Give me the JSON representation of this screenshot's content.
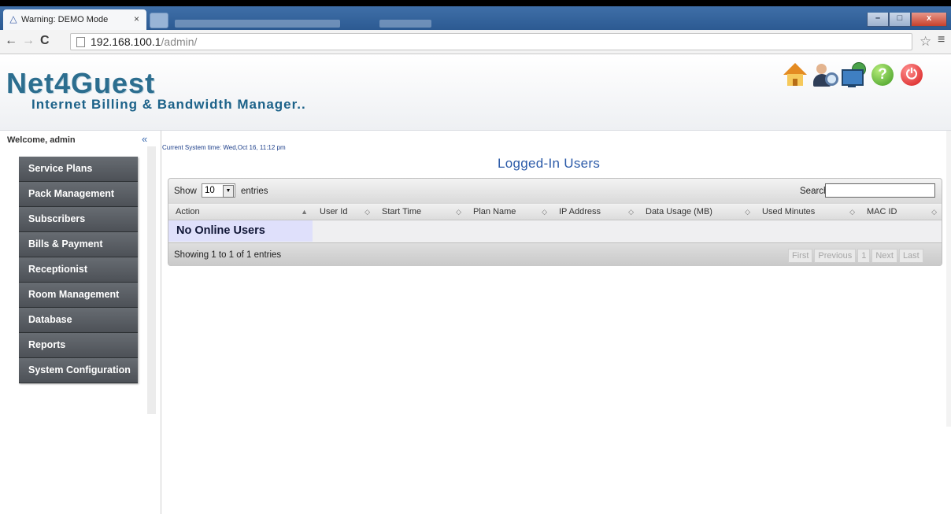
{
  "browser": {
    "tab_title": "Warning: DEMO Mode",
    "tab_close": "×",
    "url_host": "192.168.100.1",
    "url_path": "/admin/"
  },
  "header": {
    "brand": "Net4Guest",
    "tagline": "Internet Billing & Bandwidth Manager..",
    "icons": [
      "home-icon",
      "user-search-icon",
      "network-icon",
      "help-icon",
      "power-icon"
    ]
  },
  "sidebar": {
    "welcome": "Welcome, admin",
    "collapse": "«",
    "items": [
      {
        "label": "Service Plans"
      },
      {
        "label": "Pack Management"
      },
      {
        "label": "Subscribers"
      },
      {
        "label": "Bills & Payment"
      },
      {
        "label": "Receptionist"
      },
      {
        "label": "Room Management"
      },
      {
        "label": "Database"
      },
      {
        "label": "Reports"
      },
      {
        "label": "System Configuration"
      }
    ]
  },
  "main": {
    "system_time": "Current System time: Wed,Oct 16, 11:12 pm",
    "title": "Logged-In Users",
    "show_label": "Show",
    "page_length": "10",
    "entries_label": "entries",
    "search_label": "Search:",
    "search_value": "",
    "columns": [
      "Action",
      "User Id",
      "Start Time",
      "Plan Name",
      "IP Address",
      "Data Usage (MB)",
      "Used Minutes",
      "MAC ID"
    ],
    "empty_message": "No Online Users",
    "info": "Showing 1 to 1 of 1 entries",
    "pager": {
      "first": "First",
      "previous": "Previous",
      "page": "1",
      "next": "Next",
      "last": "Last"
    }
  }
}
